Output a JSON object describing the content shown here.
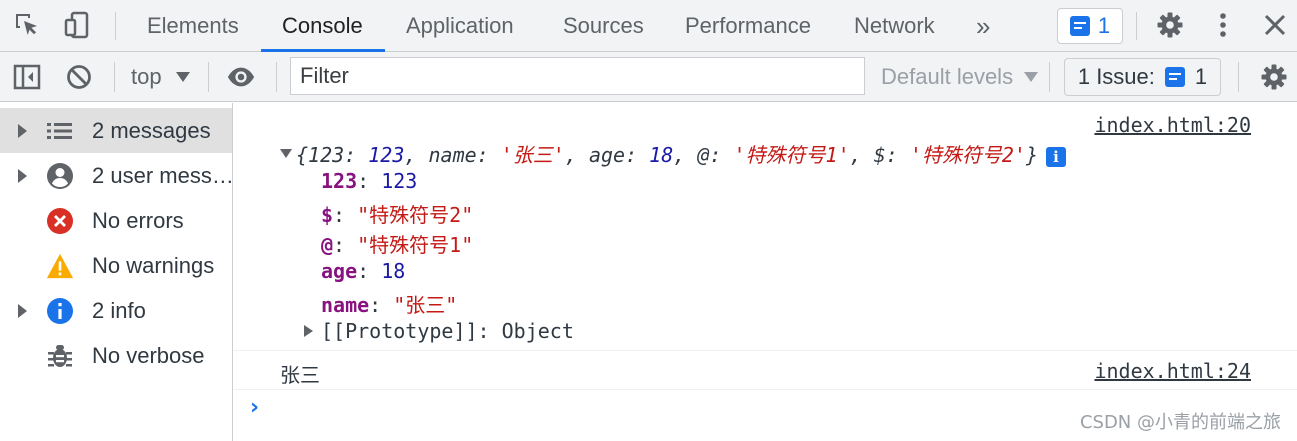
{
  "tabs": [
    {
      "label": "Elements"
    },
    {
      "label": "Console"
    },
    {
      "label": "Application"
    },
    {
      "label": "Sources"
    },
    {
      "label": "Performance"
    },
    {
      "label": "Network"
    }
  ],
  "more_tabs": "»",
  "issue_badge_count": "1",
  "toolbar": {
    "context": "top",
    "filter_placeholder": "Filter",
    "levels": "Default levels",
    "issues_label": "1 Issue:",
    "issues_count": "1"
  },
  "sidebar": {
    "items": [
      {
        "label": "2 messages",
        "icon": "list-icon"
      },
      {
        "label": "2 user mess…",
        "icon": "user-icon"
      },
      {
        "label": "No errors",
        "icon": "error-icon"
      },
      {
        "label": "No warnings",
        "icon": "warning-icon"
      },
      {
        "label": "2 info",
        "icon": "info-icon"
      },
      {
        "label": "No verbose",
        "icon": "bug-icon"
      }
    ]
  },
  "console": {
    "msg1": {
      "source": "index.html:20",
      "preview_open": "{",
      "preview": [
        {
          "key": "123",
          "val": "123",
          "type": "num"
        },
        {
          "key": "name",
          "val": "'张三'",
          "type": "str"
        },
        {
          "key": "age",
          "val": "18",
          "type": "num"
        },
        {
          "key": "@",
          "val": "'特殊符号1'",
          "type": "str"
        },
        {
          "key": "$",
          "val": "'特殊符号2'",
          "type": "str"
        }
      ],
      "preview_close": "}",
      "props": [
        {
          "key": "123",
          "val": "123",
          "type": "num"
        },
        {
          "key": "$",
          "val": "\"特殊符号2\"",
          "type": "str"
        },
        {
          "key": "@",
          "val": "\"特殊符号1\"",
          "type": "str"
        },
        {
          "key": "age",
          "val": "18",
          "type": "num"
        },
        {
          "key": "name",
          "val": "\"张三\"",
          "type": "str"
        }
      ],
      "prototype_label": "[[Prototype]]",
      "prototype_value": "Object"
    },
    "msg2": {
      "text": "张三",
      "source": "index.html:24"
    },
    "prompt": "›"
  },
  "watermark": "CSDN @小青的前端之旅",
  "colors": {
    "accent": "#1a73e8",
    "key": "#881280",
    "number": "#1a1aa6",
    "string": "#c41a16",
    "error": "#d93025",
    "warning": "#f9ab00"
  }
}
